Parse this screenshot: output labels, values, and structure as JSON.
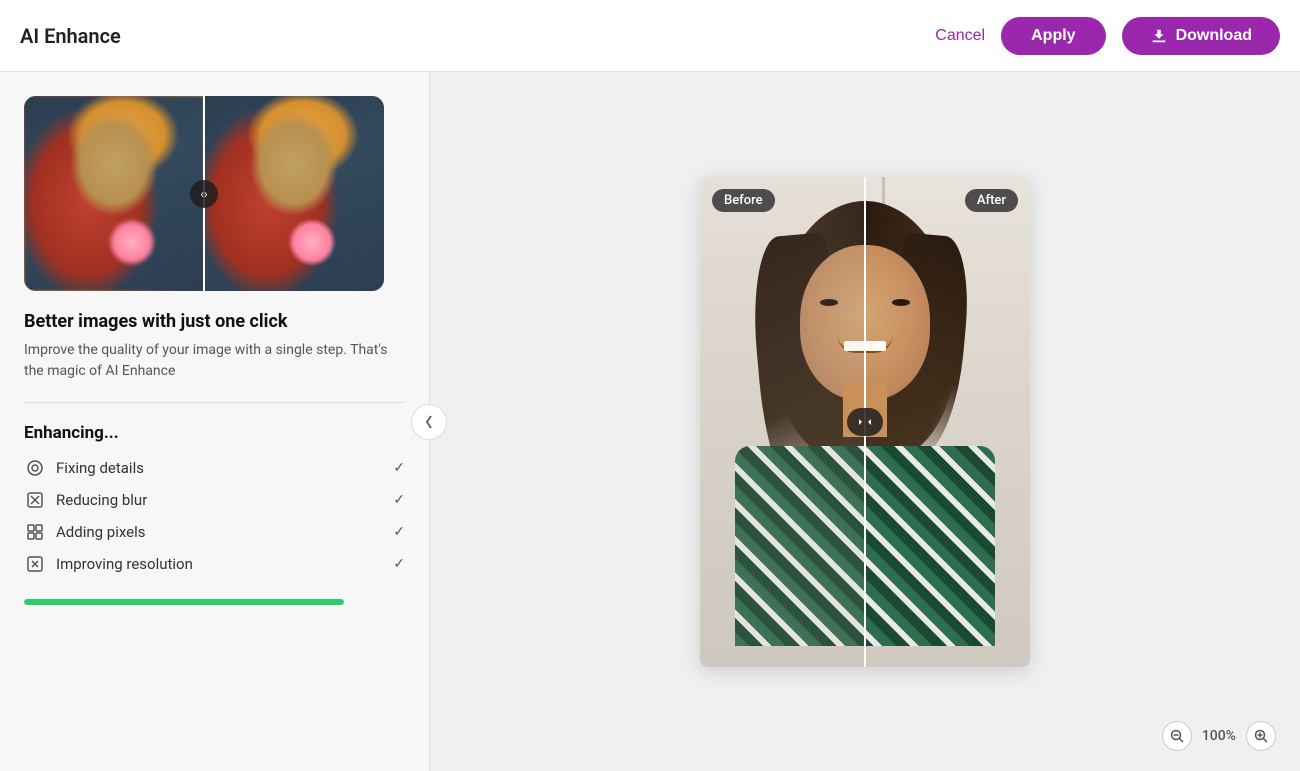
{
  "header": {
    "title": "AI Enhance",
    "cancel_label": "Cancel",
    "apply_label": "Apply",
    "download_label": "Download"
  },
  "left_panel": {
    "description_title": "Better images with just one click",
    "description_text": "Improve the quality of your image with a single step. That's the magic of AI Enhance",
    "enhancing_title": "Enhancing...",
    "enhance_items": [
      {
        "label": "Fixing details",
        "done": true
      },
      {
        "label": "Reducing blur",
        "done": true
      },
      {
        "label": "Adding pixels",
        "done": true
      },
      {
        "label": "Improving resolution",
        "done": true
      }
    ],
    "progress_percent": 100
  },
  "image_viewer": {
    "before_label": "Before",
    "after_label": "After"
  },
  "zoom_controls": {
    "level": "100%",
    "zoom_in_label": "+",
    "zoom_out_label": "−"
  }
}
